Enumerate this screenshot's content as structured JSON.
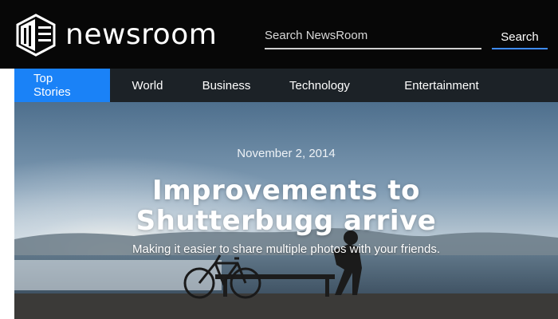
{
  "header": {
    "logo_text": "newsroom",
    "logo_icon": "newspaper-building-icon",
    "search": {
      "placeholder": "Search NewsRoom",
      "value": ""
    },
    "search_button_label": "Search"
  },
  "nav": {
    "items": [
      {
        "label": "Top Stories",
        "active": true
      },
      {
        "label": "World"
      },
      {
        "label": "Business"
      },
      {
        "label": "Technology"
      },
      {
        "label": "Entertainment"
      }
    ]
  },
  "hero": {
    "date": "November 2, 2014",
    "title_line1": "Improvements to",
    "title_line2": "Shutterbugg arrive",
    "subtitle": "Making it easier to share multiple photos with your friends."
  },
  "colors": {
    "header_bg": "#070707",
    "nav_bg": "#1c2227",
    "nav_active": "#1a82f7",
    "search_underline": "#3e8cff"
  }
}
